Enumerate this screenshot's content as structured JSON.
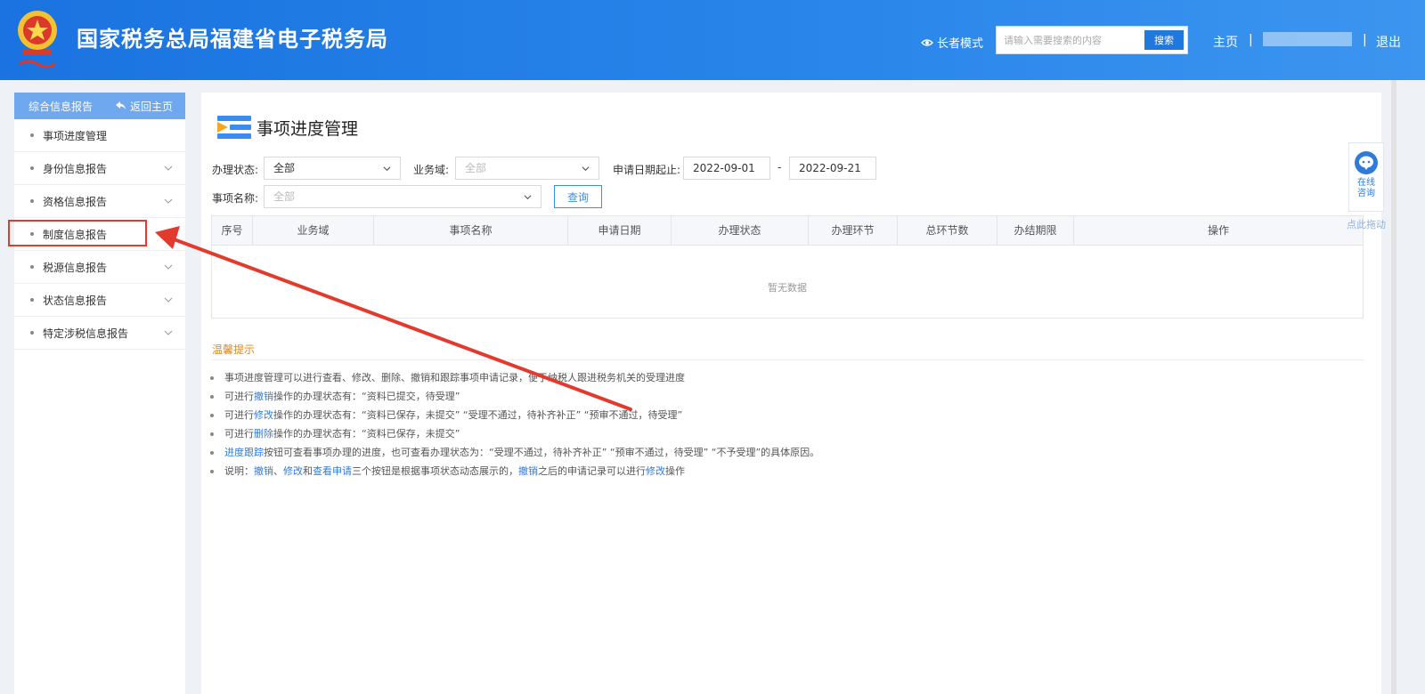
{
  "header": {
    "site_title": "国家税务总局福建省电子税务局",
    "elder_mode": "长者模式",
    "search_placeholder": "请输入需要搜索的内容",
    "search_button": "搜索",
    "home": "主页",
    "separator": "|",
    "logout": "退出"
  },
  "sidebar": {
    "title": "综合信息报告",
    "back": "返回主页",
    "items": [
      {
        "label": "事项进度管理"
      },
      {
        "label": "身份信息报告"
      },
      {
        "label": "资格信息报告"
      },
      {
        "label": "制度信息报告"
      },
      {
        "label": "税源信息报告"
      },
      {
        "label": "状态信息报告"
      },
      {
        "label": "特定涉税信息报告"
      }
    ]
  },
  "main": {
    "title": "事项进度管理",
    "filters": {
      "status_label": "办理状态:",
      "status_value": "全部",
      "domain_label": "业务域:",
      "domain_value": "全部",
      "date_label": "申请日期起止:",
      "date_start": "2022-09-01",
      "date_dash": "-",
      "date_end": "2022-09-21",
      "item_label": "事项名称:",
      "item_value": "全部",
      "query_button": "查询"
    },
    "table": {
      "columns": [
        "序号",
        "业务域",
        "事项名称",
        "申请日期",
        "办理状态",
        "办理环节",
        "总环节数",
        "办结期限",
        "操作"
      ],
      "empty": "暂无数据"
    },
    "tips": {
      "title": "温馨提示",
      "l1": "事项进度管理可以进行查看、修改、删除、撤销和跟踪事项申请记录，便于纳税人跟进税务机关的受理进度",
      "l2a": "可进行",
      "l2b": "撤销",
      "l2c": "操作的办理状态有：“资料已提交，待受理”",
      "l3a": "可进行",
      "l3b": "修改",
      "l3c": "操作的办理状态有：“资料已保存，未提交”  “受理不通过，待补齐补正”  “预审不通过，待受理”",
      "l4a": "可进行",
      "l4b": "删除",
      "l4c": "操作的办理状态有：“资料已保存，未提交”",
      "l5a": "进度跟踪",
      "l5b": "按钮可查看事项办理的进度，也可查看办理状态为：“受理不通过，待补齐补正”  “预审不通过，待受理”  “不予受理”的具体原因。",
      "l6a": "说明：",
      "l6b": "撤销",
      "l6c": "、",
      "l6d": "修改",
      "l6e": "和",
      "l6f": "查看申请",
      "l6g": "三个按钮是根据事项状态动态展示的，",
      "l6h": "撤销",
      "l6i": "之后的申请记录可以进行",
      "l6j": "修改",
      "l6k": "操作"
    }
  },
  "consult": {
    "line1": "在线",
    "line2": "咨询",
    "drag_hint": "点此拖动"
  },
  "colors": {
    "header_blue": "#1a73e0",
    "accent_blue": "#2f7bd8",
    "highlight_red": "#e23b2e",
    "tips_orange": "#e7860f"
  }
}
